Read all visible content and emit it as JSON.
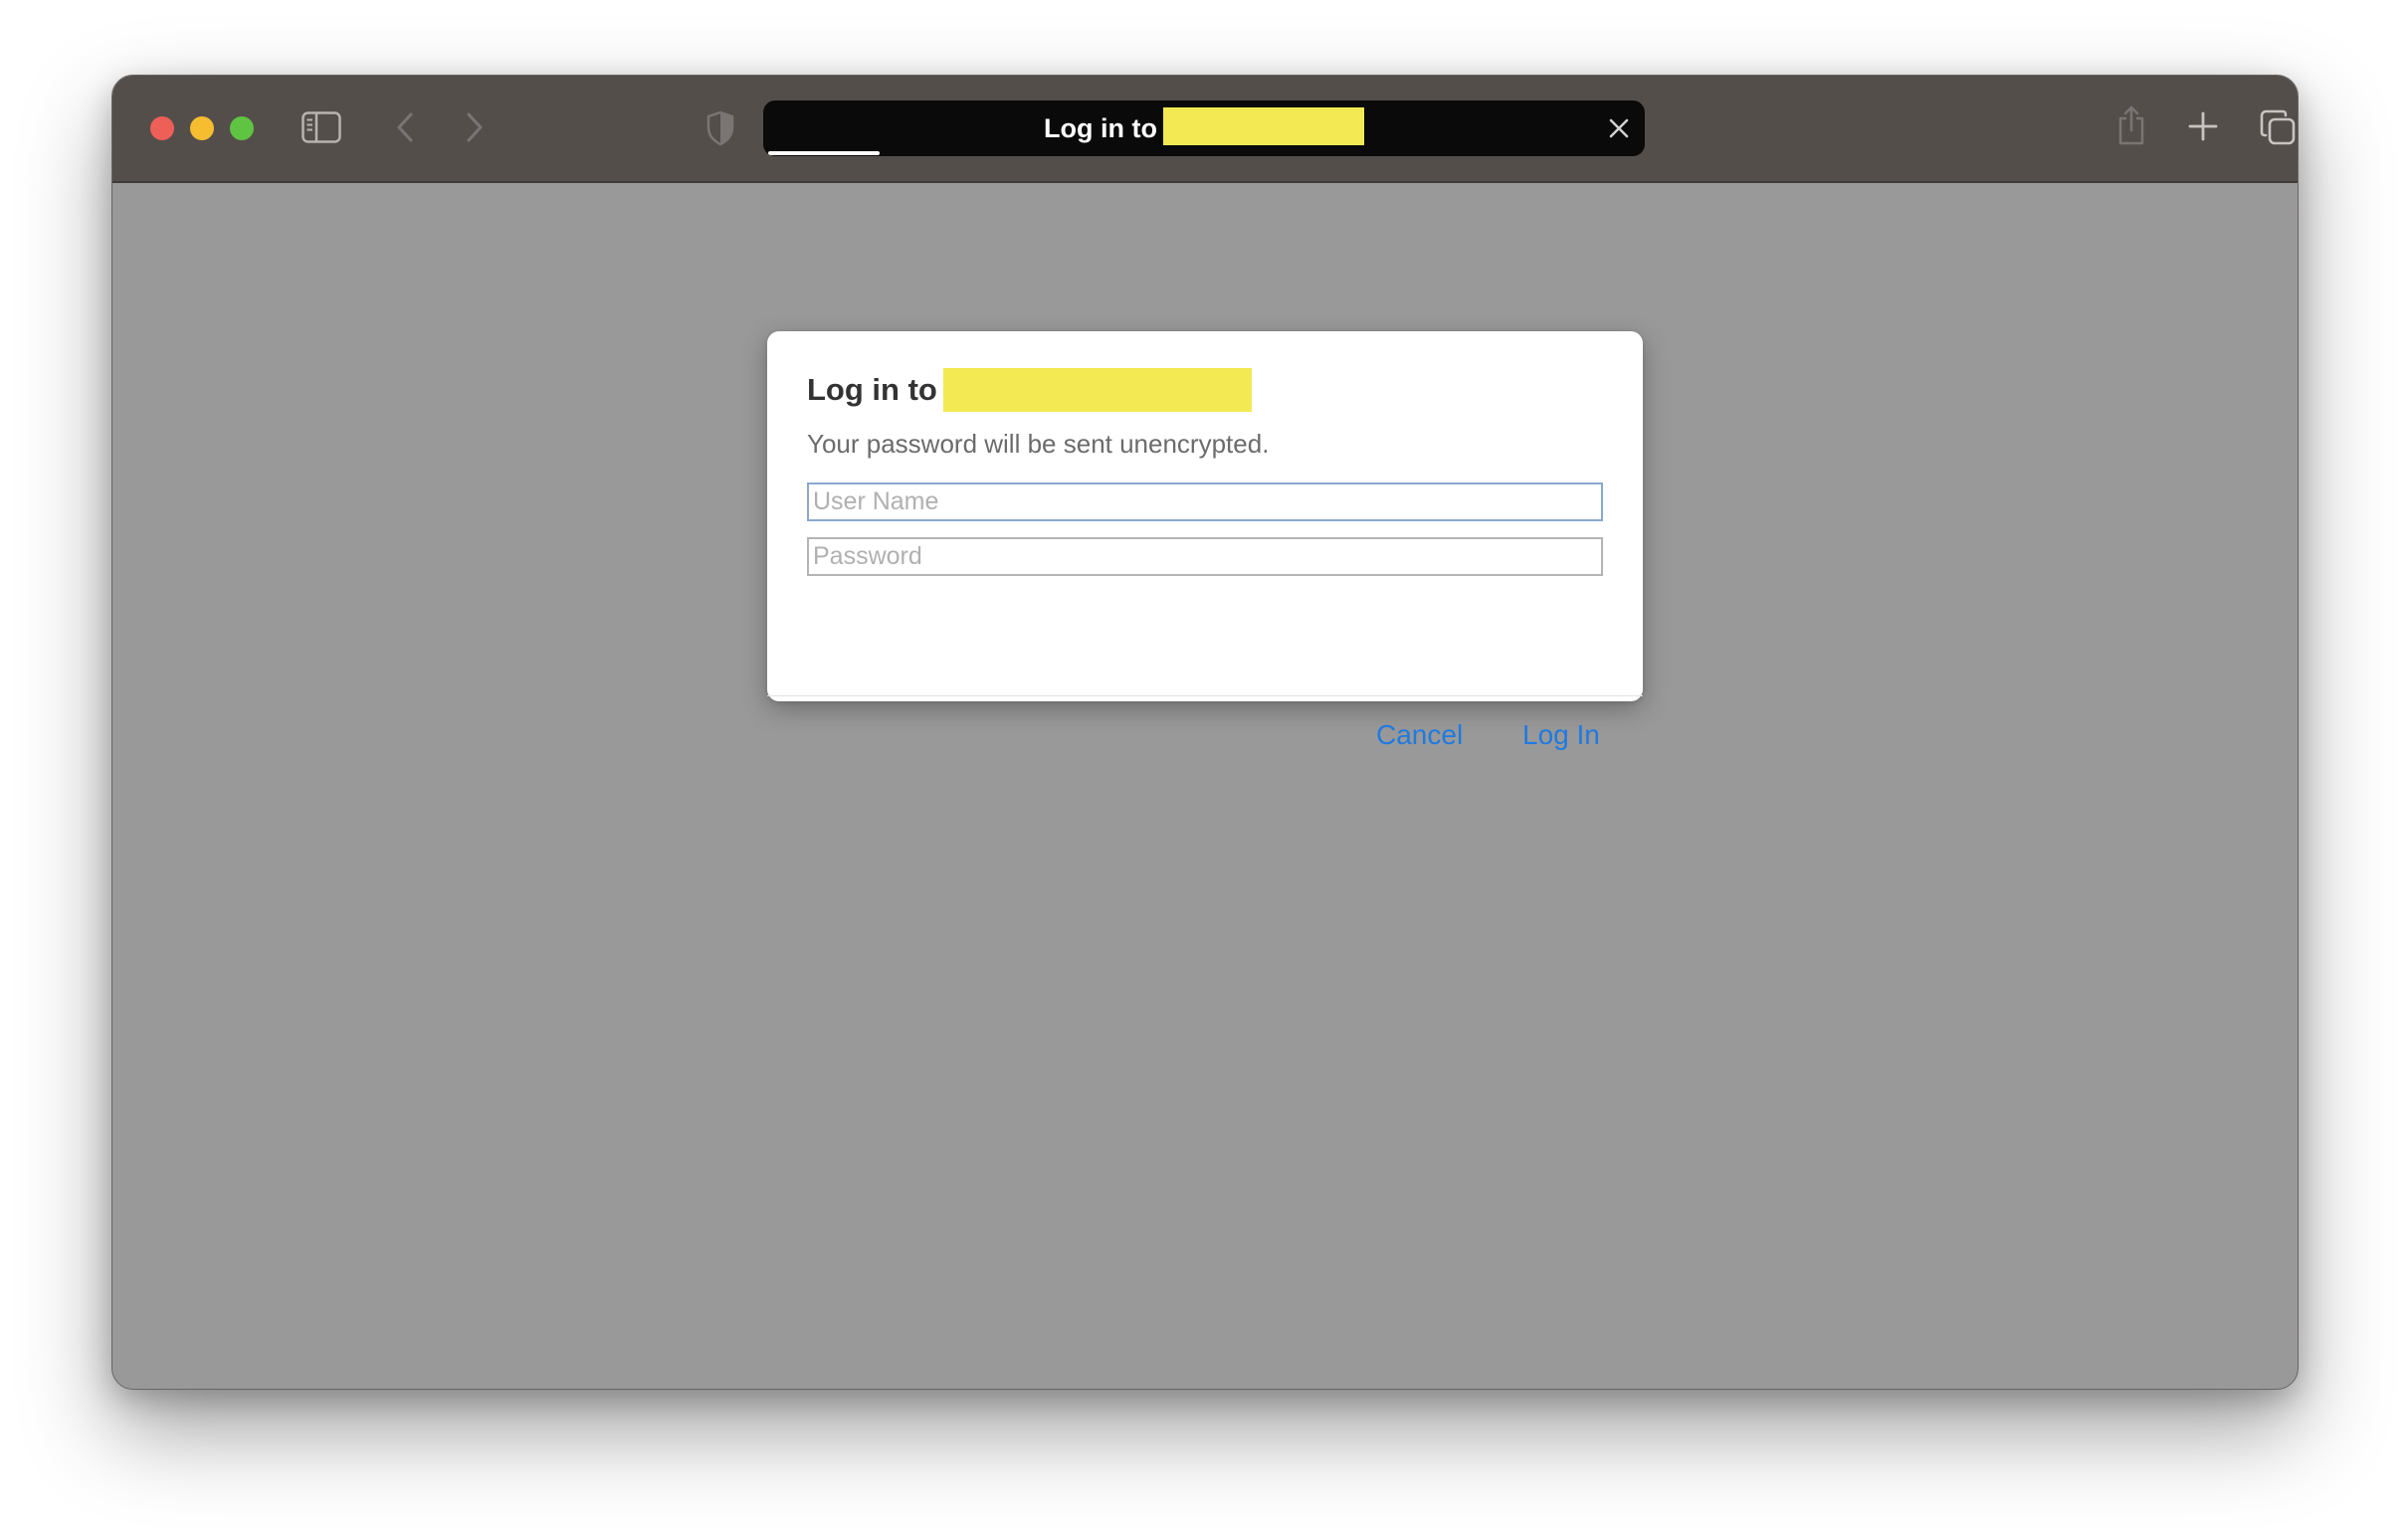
{
  "browser": {
    "url_bar_text": "Log in to",
    "colors": {
      "toolbar_bg": "#544e4b",
      "content_bg": "#999999",
      "redaction": "#f3ea53",
      "close": "#ee5f57",
      "minimize": "#f5bd2f",
      "zoom": "#5ec442"
    },
    "icons": {
      "sidebar": "sidebar-icon",
      "back": "chevron-left-icon",
      "forward": "chevron-right-icon",
      "privacy": "shield-icon",
      "clear": "close-icon",
      "share": "share-icon",
      "new_tab": "plus-icon",
      "tabs": "tab-overview-icon"
    }
  },
  "dialog": {
    "title": "Log in to",
    "subtitle": "Your password will be sent unencrypted.",
    "username_placeholder": "User Name",
    "password_placeholder": "Password",
    "cancel_label": "Cancel",
    "login_label": "Log In",
    "accent_color": "#1f7ae0"
  }
}
